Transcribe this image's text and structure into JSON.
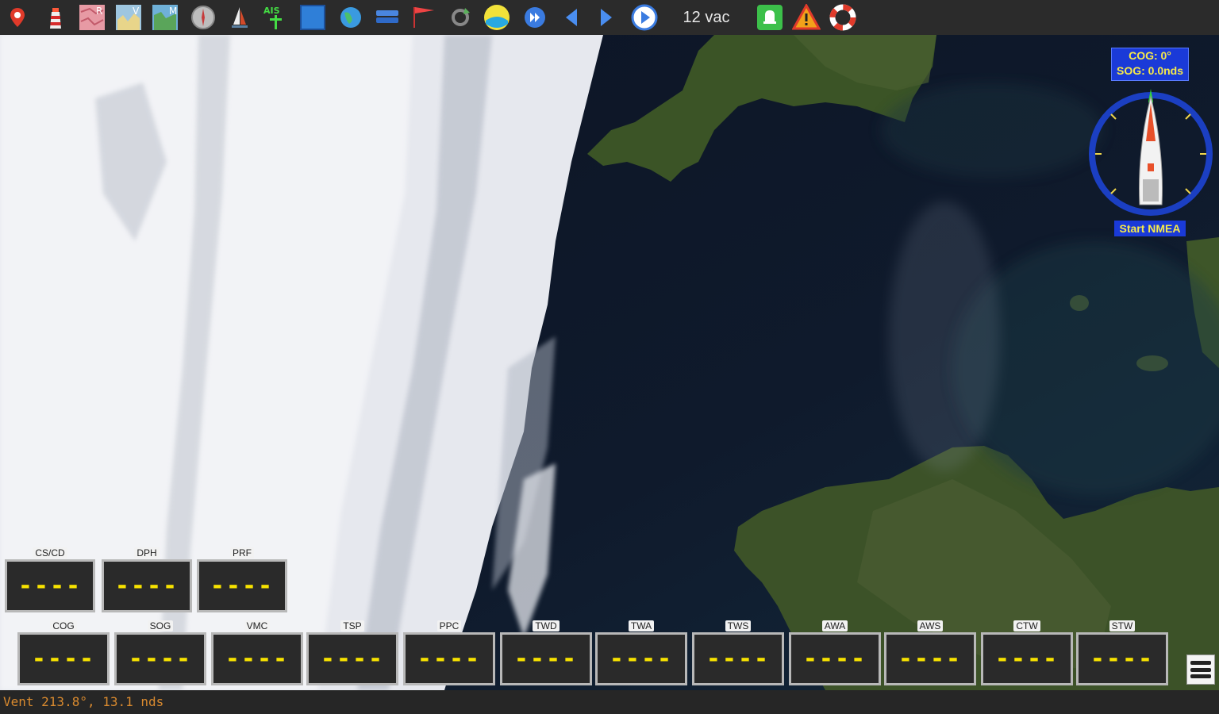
{
  "toolbar": {
    "icons": [
      "position-marker-icon",
      "lighthouse-icon",
      "raster-chart-icon",
      "vector-chart-icon",
      "map-chart-icon",
      "compass-rose-icon",
      "sailboat-icon",
      "ais-icon",
      "satellite-layer-icon",
      "globe-icon",
      "layers-icon",
      "flag-icon",
      "refresh-icon",
      "weather-sun-icon",
      "fast-forward-icon",
      "previous-icon",
      "next-icon",
      "play-icon",
      "bell-icon",
      "warning-icon",
      "lifebuoy-icon"
    ],
    "battery_label": "12 vac"
  },
  "colors": {
    "toolbar_bg": "#2b2b2b",
    "instrument_bg": "#2a2a2a",
    "instrument_value": "#f7e200",
    "compass_box": "#1a3ad8",
    "status_text": "#d98a2f"
  },
  "compass": {
    "cog_label": "COG: 0°",
    "sog_label": "SOG: 0.0nds",
    "start_button": "Start NMEA"
  },
  "instruments_top": [
    {
      "label": "CS/CD",
      "value": "----"
    },
    {
      "label": "DPH",
      "value": "----"
    },
    {
      "label": "PRF",
      "value": "----"
    }
  ],
  "instruments_bottom": [
    {
      "label": "COG",
      "value": "----"
    },
    {
      "label": "SOG",
      "value": "----"
    },
    {
      "label": "VMC",
      "value": "----"
    },
    {
      "label": "TSP",
      "value": "----"
    },
    {
      "label": "PPC",
      "value": "----"
    },
    {
      "label": "TWD",
      "value": "----"
    },
    {
      "label": "TWA",
      "value": "----"
    },
    {
      "label": "TWS",
      "value": "----"
    },
    {
      "label": "AWA",
      "value": "----"
    },
    {
      "label": "AWS",
      "value": "----"
    },
    {
      "label": "CTW",
      "value": "----"
    },
    {
      "label": "STW",
      "value": "----"
    }
  ],
  "status": {
    "wind_text": "Vent 213.8°, 13.1 nds"
  }
}
